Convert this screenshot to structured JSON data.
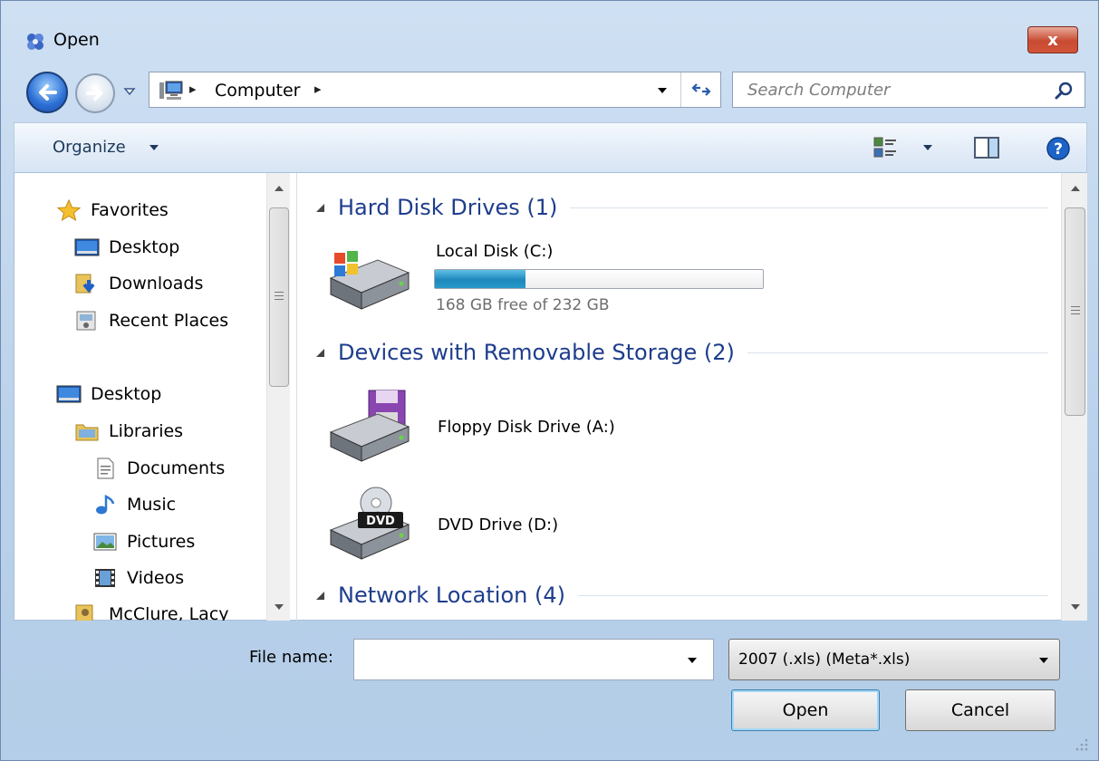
{
  "window": {
    "title": "Open",
    "close_label": "x"
  },
  "address_bar": {
    "location": "Computer",
    "separator": "▸"
  },
  "search": {
    "placeholder": "Search Computer"
  },
  "toolbar": {
    "organize_label": "Organize"
  },
  "nav_pane": {
    "favorites_label": "Favorites",
    "items": [
      {
        "label": "Desktop"
      },
      {
        "label": "Downloads"
      },
      {
        "label": "Recent Places"
      }
    ],
    "tree": [
      {
        "label": "Desktop"
      },
      {
        "label": "Libraries"
      },
      {
        "label": "Documents"
      },
      {
        "label": "Music"
      },
      {
        "label": "Pictures"
      },
      {
        "label": "Videos"
      },
      {
        "label": "McClure, Lacy"
      }
    ]
  },
  "groups": {
    "hard_disk": {
      "label": "Hard Disk Drives (1)",
      "drives": [
        {
          "name": "Local Disk (C:)",
          "free_text": "168 GB free of 232 GB",
          "used_fraction": 0.276
        }
      ]
    },
    "removable": {
      "label": "Devices with Removable Storage (2)",
      "drives": [
        {
          "name": "Floppy Disk Drive (A:)"
        },
        {
          "name": "DVD Drive (D:)",
          "badge": "DVD"
        }
      ]
    },
    "network": {
      "label": "Network Location (4)"
    }
  },
  "footer": {
    "file_name_label": "File name:",
    "file_name_value": "",
    "file_type_selected": "2007 (.xls) (Meta*.xls)",
    "open_label": "Open",
    "cancel_label": "Cancel"
  },
  "colors": {
    "group_header": "#1e3d8c",
    "capacity_fill": "#2899c9",
    "close_button": "#c74a31"
  }
}
